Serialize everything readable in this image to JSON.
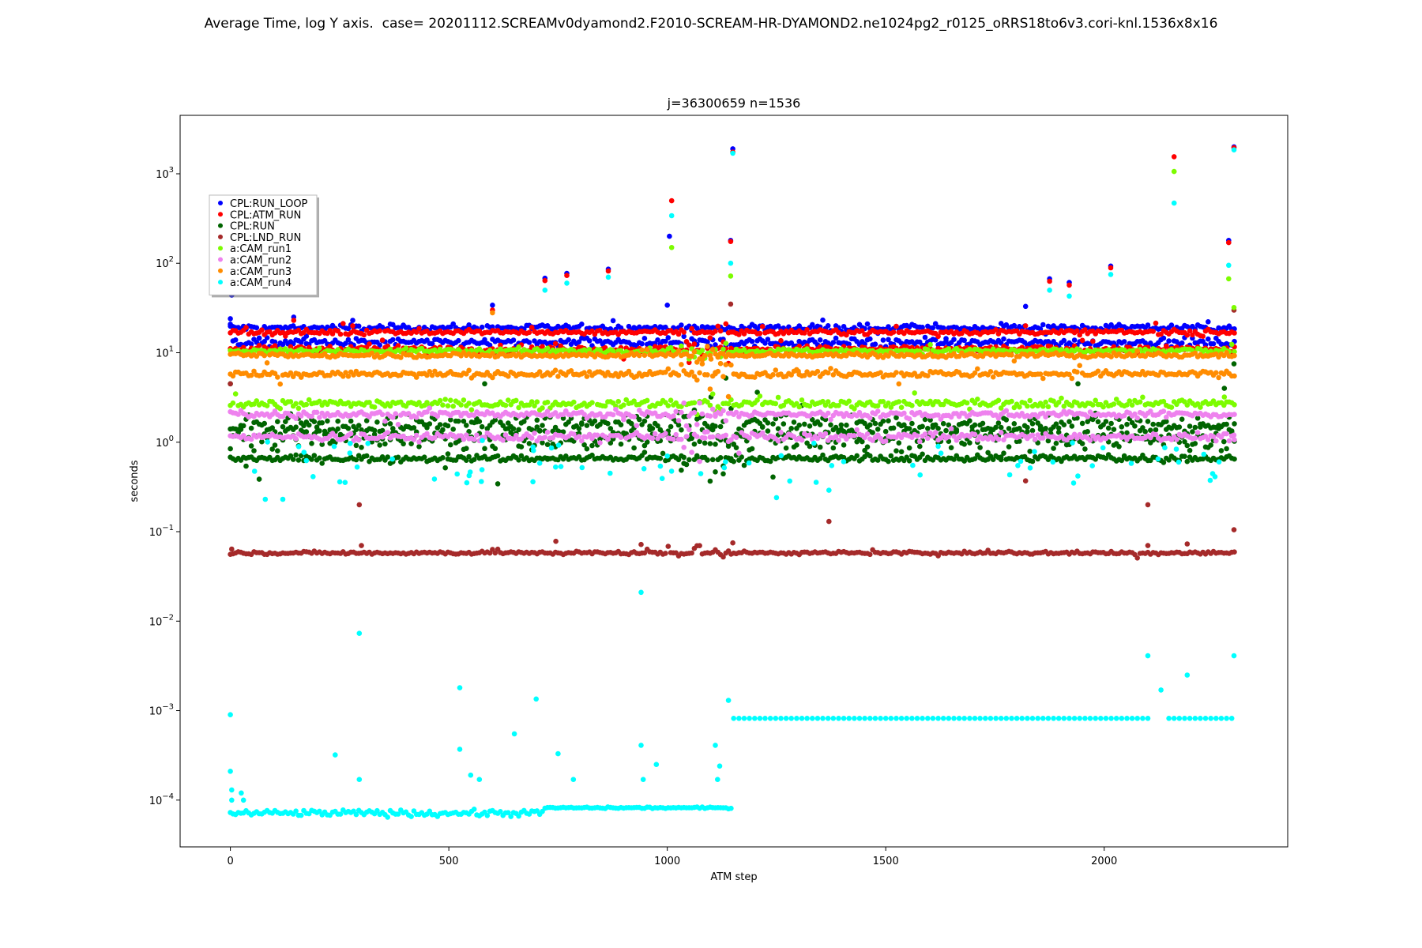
{
  "figure": {
    "suptitle": "Average Time, log Y axis.  case= 20201112.SCREAMv0dyamond2.F2010-SCREAM-HR-DYAMOND2.ne1024pg2_r0125_oRRS18to6v3.cori-knl.1536x8x16"
  },
  "chart_data": {
    "type": "scatter",
    "title": "j=36300659 n=1536",
    "xlabel": "ATM step",
    "ylabel": "seconds",
    "xlim": [
      -115,
      2420
    ],
    "ylim": [
      3e-05,
      4500
    ],
    "yscale": "log",
    "grid": false,
    "legend_position": "upper-left",
    "x_ticks": [
      0,
      500,
      1000,
      1500,
      2000
    ],
    "x_tick_labels": [
      "0",
      "500",
      "1000",
      "1500",
      "2000"
    ],
    "y_ticks": [
      0.0001,
      0.001,
      0.01,
      0.1,
      1,
      10,
      100,
      1000
    ],
    "y_tick_labels": [
      {
        "base": "10",
        "exp": "−4"
      },
      {
        "base": "10",
        "exp": "−3"
      },
      {
        "base": "10",
        "exp": "−2"
      },
      {
        "base": "10",
        "exp": "−1"
      },
      {
        "base": "10",
        "exp": "0"
      },
      {
        "base": "10",
        "exp": "1"
      },
      {
        "base": "10",
        "exp": "2"
      },
      {
        "base": "10",
        "exp": "3"
      }
    ],
    "x_max_step": 2300,
    "series": [
      {
        "name": "CPL:RUN_LOOP",
        "color": "#0000ff",
        "bands": [
          [
            19,
            0.04
          ],
          [
            13,
            0.05
          ]
        ],
        "outliers": [
          [
            0,
            24
          ],
          [
            3,
            44
          ],
          [
            145,
            25
          ],
          [
            280,
            23
          ],
          [
            600,
            34
          ],
          [
            720,
            68
          ],
          [
            770,
            77
          ],
          [
            865,
            86
          ],
          [
            1000,
            34
          ],
          [
            1005,
            200
          ],
          [
            1145,
            180
          ],
          [
            1150,
            1900
          ],
          [
            1820,
            33
          ],
          [
            1875,
            67
          ],
          [
            1920,
            61
          ],
          [
            2015,
            93
          ],
          [
            2285,
            180
          ],
          [
            2297,
            2000
          ]
        ]
      },
      {
        "name": "CPL:ATM_RUN",
        "color": "#ff0000",
        "bands": [
          [
            17,
            0.03
          ],
          [
            11,
            0.04
          ]
        ],
        "outliers": [
          [
            145,
            23
          ],
          [
            280,
            20
          ],
          [
            600,
            30
          ],
          [
            720,
            64
          ],
          [
            770,
            73
          ],
          [
            865,
            82
          ],
          [
            1010,
            500
          ],
          [
            1145,
            175
          ],
          [
            1150,
            1750
          ],
          [
            1820,
            20
          ],
          [
            1875,
            63
          ],
          [
            1920,
            57
          ],
          [
            2015,
            89
          ],
          [
            2160,
            1550
          ],
          [
            2285,
            170
          ],
          [
            2297,
            1950
          ]
        ]
      },
      {
        "name": "CPL:RUN",
        "color": "#006400",
        "bands": [
          [
            0.66,
            0.04
          ],
          [
            1.1,
            0.16
          ],
          [
            1.55,
            0.12
          ]
        ],
        "outliers": [
          [
            0,
            4.5
          ],
          [
            1100,
            3.2
          ],
          [
            1940,
            4.5
          ],
          [
            2275,
            4.0
          ],
          [
            2297,
            7.5
          ]
        ]
      },
      {
        "name": "CPL:LND_RUN",
        "color": "#a52a2a",
        "bands": [
          [
            0.058,
            0.02
          ]
        ],
        "outliers": [
          [
            0,
            4.5
          ],
          [
            3,
            0.064
          ],
          [
            295,
            0.2
          ],
          [
            300,
            0.07
          ],
          [
            745,
            0.078
          ],
          [
            940,
            0.072
          ],
          [
            1150,
            0.075
          ],
          [
            1145,
            35
          ],
          [
            1370,
            0.13
          ],
          [
            1820,
            0.37
          ],
          [
            2100,
            0.2
          ],
          [
            2100,
            0.07
          ],
          [
            2190,
            0.073
          ],
          [
            2297,
            0.105
          ],
          [
            2297,
            30
          ]
        ]
      },
      {
        "name": "a:CAM_run1",
        "color": "#7cfc00",
        "bands": [
          [
            10.5,
            0.03
          ],
          [
            2.7,
            0.05
          ]
        ],
        "outliers": [
          [
            1010,
            150
          ],
          [
            1145,
            72
          ],
          [
            2160,
            1060
          ],
          [
            2285,
            67
          ],
          [
            2297,
            32
          ],
          [
            2275,
            3.2
          ]
        ]
      },
      {
        "name": "a:CAM_run2",
        "color": "#ee82ee",
        "bands": [
          [
            2.05,
            0.04
          ],
          [
            1.15,
            0.05
          ]
        ],
        "outliers": [
          [
            2297,
            1.2
          ]
        ]
      },
      {
        "name": "a:CAM_run3",
        "color": "#ff8c00",
        "bands": [
          [
            9.4,
            0.03
          ],
          [
            5.8,
            0.04
          ]
        ],
        "outliers": [
          [
            600,
            28
          ],
          [
            1080,
            7.5
          ],
          [
            1100,
            8.5
          ],
          [
            1110,
            6.0
          ],
          [
            1300,
            6.2
          ]
        ]
      },
      {
        "name": "a:CAM_run4",
        "color": "#00ffff",
        "bands": [],
        "outliers": [
          [
            0,
            0.0009
          ],
          [
            0,
            0.00021
          ],
          [
            3,
            0.00013
          ],
          [
            3,
            0.0001
          ],
          [
            25,
            0.00012
          ],
          [
            30,
            0.0001
          ],
          [
            295,
            0.0073
          ],
          [
            295,
            0.00017
          ],
          [
            240,
            0.00032
          ],
          [
            525,
            0.0018
          ],
          [
            525,
            0.00037
          ],
          [
            550,
            0.00019
          ],
          [
            570,
            0.00017
          ],
          [
            650,
            0.00055
          ],
          [
            700,
            0.00135
          ],
          [
            750,
            0.00033
          ],
          [
            785,
            0.00017
          ],
          [
            940,
            0.021
          ],
          [
            940,
            0.00041
          ],
          [
            945,
            0.00017
          ],
          [
            975,
            0.00025
          ],
          [
            1140,
            0.0013
          ],
          [
            1110,
            0.00041
          ],
          [
            1120,
            0.00024
          ],
          [
            1115,
            0.00017
          ],
          [
            2100,
            0.0041
          ],
          [
            2130,
            0.0017
          ],
          [
            2190,
            0.0025
          ],
          [
            2297,
            0.0041
          ],
          [
            720,
            50
          ],
          [
            770,
            60
          ],
          [
            865,
            70
          ],
          [
            1010,
            340
          ],
          [
            1145,
            100
          ],
          [
            1150,
            1700
          ],
          [
            1875,
            50
          ],
          [
            1920,
            43
          ],
          [
            2015,
            75
          ],
          [
            2160,
            470
          ],
          [
            2285,
            95
          ],
          [
            2297,
            1850
          ],
          [
            80,
            0.23
          ],
          [
            120,
            0.23
          ],
          [
            1250,
            0.24
          ],
          [
            1370,
            0.29
          ],
          [
            1620,
            0.9
          ],
          [
            1000,
            0.7
          ]
        ]
      }
    ]
  }
}
